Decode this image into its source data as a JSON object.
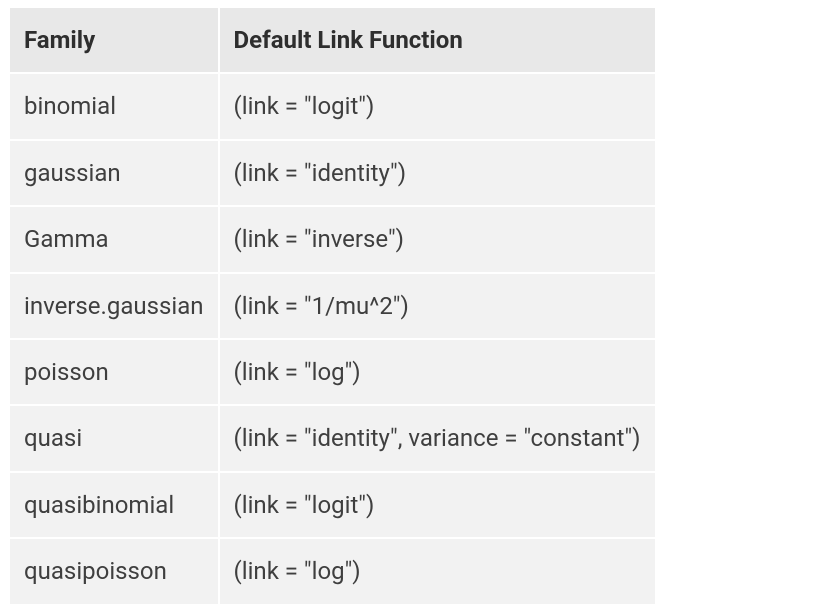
{
  "table": {
    "headers": [
      "Family",
      "Default Link Function"
    ],
    "rows": [
      {
        "family": "binomial",
        "link": "(link = \"logit\")"
      },
      {
        "family": "gaussian",
        "link": "(link = \"identity\")"
      },
      {
        "family": "Gamma",
        "link": "(link = \"inverse\")"
      },
      {
        "family": "inverse.gaussian",
        "link": "(link = \"1/mu^2\")"
      },
      {
        "family": "poisson",
        "link": "(link = \"log\")"
      },
      {
        "family": "quasi",
        "link": "(link = \"identity\", variance = \"constant\")"
      },
      {
        "family": "quasibinomial",
        "link": "(link = \"logit\")"
      },
      {
        "family": "quasipoisson",
        "link": "(link = \"log\")"
      }
    ]
  }
}
